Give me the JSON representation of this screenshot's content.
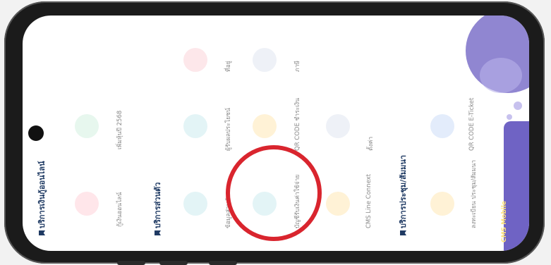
{
  "sections": {
    "online_loan": {
      "title": "บริการเงินกู้ออนไลน์",
      "items": [
        "กู้เงินออนไลน์",
        "เพิ่มหุ้นปี 2568"
      ]
    },
    "personal": {
      "title": "บริการส่วนตัว",
      "items": [
        "ข้อมูลส่วนตัว",
        "ผู้รับผลประโยชน์",
        "ที่อยู่",
        "บัญชีรับเงินค่าใช้จ่าย",
        "QR CODE ชำระเงิน",
        "ภาษี",
        "CMS Line Connext",
        "ตั้งค่า"
      ]
    },
    "meeting": {
      "title": "บริการประชุม/สัมมนา",
      "items": [
        "ลงทะเบียน ประชุม/สัมมนา",
        "QR CODE E-Ticket"
      ]
    }
  },
  "footer": {
    "label": "CMS Mobile"
  },
  "icons": [
    "money-bag-icon",
    "hand-coin-icon",
    "person-icon",
    "document-icon",
    "location-pin-icon",
    "handshake-icon",
    "qr-icon",
    "settings-icon",
    "map-icon",
    "line-chat-icon",
    "meeting-icon",
    "eticket-icon"
  ],
  "colors": {
    "accent": "#7d71c9",
    "title": "#1f3a63",
    "highlight": "#d9252e"
  }
}
